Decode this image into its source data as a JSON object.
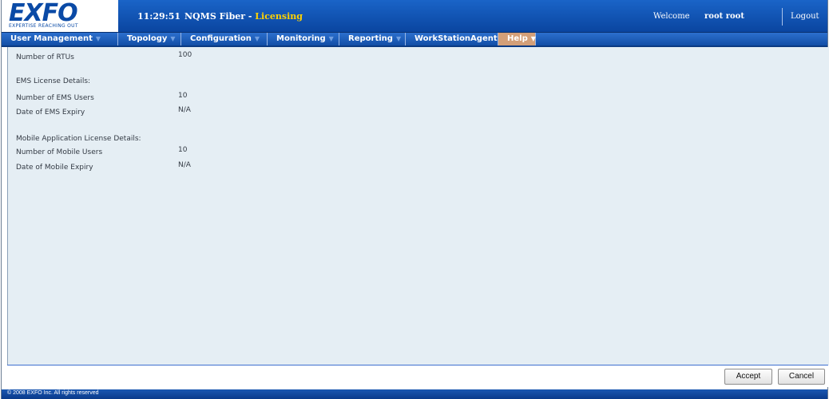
{
  "header": {
    "logo": "EXFO",
    "logo_tagline": "EXPERTISE REACHING OUT",
    "time": "11:29:51",
    "app_name": "NQMS Fiber",
    "separator": " - ",
    "page_name": "Licensing",
    "welcome_label": "Welcome",
    "user_name": "root root",
    "logout_label": "Logout"
  },
  "menu": {
    "items": [
      {
        "label": "User Management"
      },
      {
        "label": "Topology"
      },
      {
        "label": "Configuration"
      },
      {
        "label": "Monitoring"
      },
      {
        "label": "Reporting"
      },
      {
        "label": "WorkStationAgent"
      },
      {
        "label": "Help"
      }
    ],
    "active": "Help",
    "caret": "▼"
  },
  "content": {
    "rtus_label": "Number of RTUs",
    "rtus_value": "100",
    "ems_section": "EMS License Details:",
    "ems_users_label": "Number of EMS Users",
    "ems_users_value": "10",
    "ems_expiry_label": "Date of EMS Expiry",
    "ems_expiry_value": "N/A",
    "mobile_section": "Mobile Application License Details:",
    "mobile_users_label": "Number of Mobile Users",
    "mobile_users_value": "10",
    "mobile_expiry_label": "Date of Mobile Expiry",
    "mobile_expiry_value": "N/A"
  },
  "actions": {
    "accept_label": "Accept",
    "cancel_label": "Cancel"
  },
  "footer": {
    "copyright": "© 2008 EXFO Inc. All rights reserved"
  },
  "colors": {
    "header_blue": "#0a45a0",
    "page_title_yellow": "#ffd200",
    "active_menu": "#d39f78",
    "content_bg": "#e5eef4"
  }
}
